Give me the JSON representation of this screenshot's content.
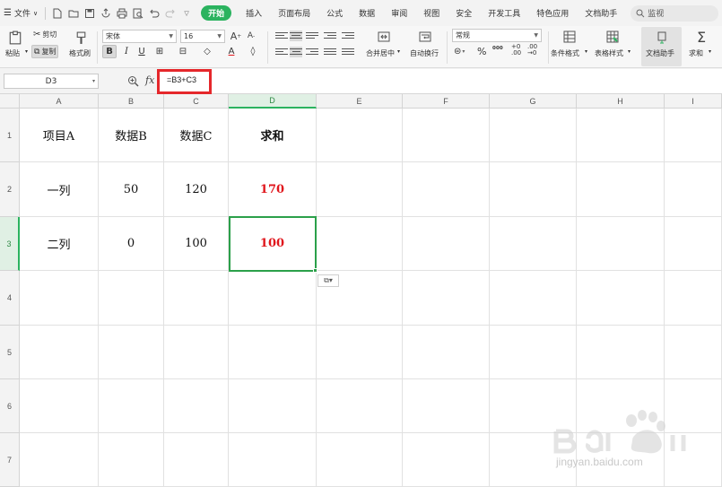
{
  "menubar": {
    "file_label": "文件",
    "tabs": [
      "开始",
      "插入",
      "页面布局",
      "公式",
      "数据",
      "审阅",
      "视图",
      "安全",
      "开发工具",
      "特色应用",
      "文档助手"
    ],
    "active_tab": "开始",
    "search_label": "监视"
  },
  "ribbon": {
    "paste": "粘贴",
    "cut": "剪切",
    "copy": "复制",
    "format_painter": "格式刷",
    "font_name": "宋体",
    "font_size": "16",
    "merge_center": "合并居中",
    "wrap_text": "自动换行",
    "number_format": "常规",
    "conditional_format": "条件格式",
    "table_style": "表格样式",
    "doc_helper": "文档助手",
    "sum": "求和"
  },
  "formula_bar": {
    "name_box": "D3",
    "fx": "fx",
    "formula": "=B3+C3"
  },
  "grid": {
    "columns": [
      "A",
      "B",
      "C",
      "D",
      "E",
      "F",
      "G",
      "H",
      "I"
    ],
    "rows": [
      "1",
      "2",
      "3",
      "4",
      "5",
      "6",
      "7"
    ],
    "selected_column": "D",
    "selected_row": "3",
    "cells": {
      "A1": "项目A",
      "B1": "数据B",
      "C1": "数据C",
      "D1": "求和",
      "A2": "一列",
      "B2": "50",
      "C2": "120",
      "D2": "170",
      "A3": "二列",
      "B3": "0",
      "C3": "100",
      "D3": "100"
    }
  },
  "colors": {
    "accent_green": "#2bb35f",
    "highlight_red": "#e5272b",
    "result_red": "#e0161c"
  },
  "watermark": {
    "text": "jingyan.baidu.com"
  }
}
